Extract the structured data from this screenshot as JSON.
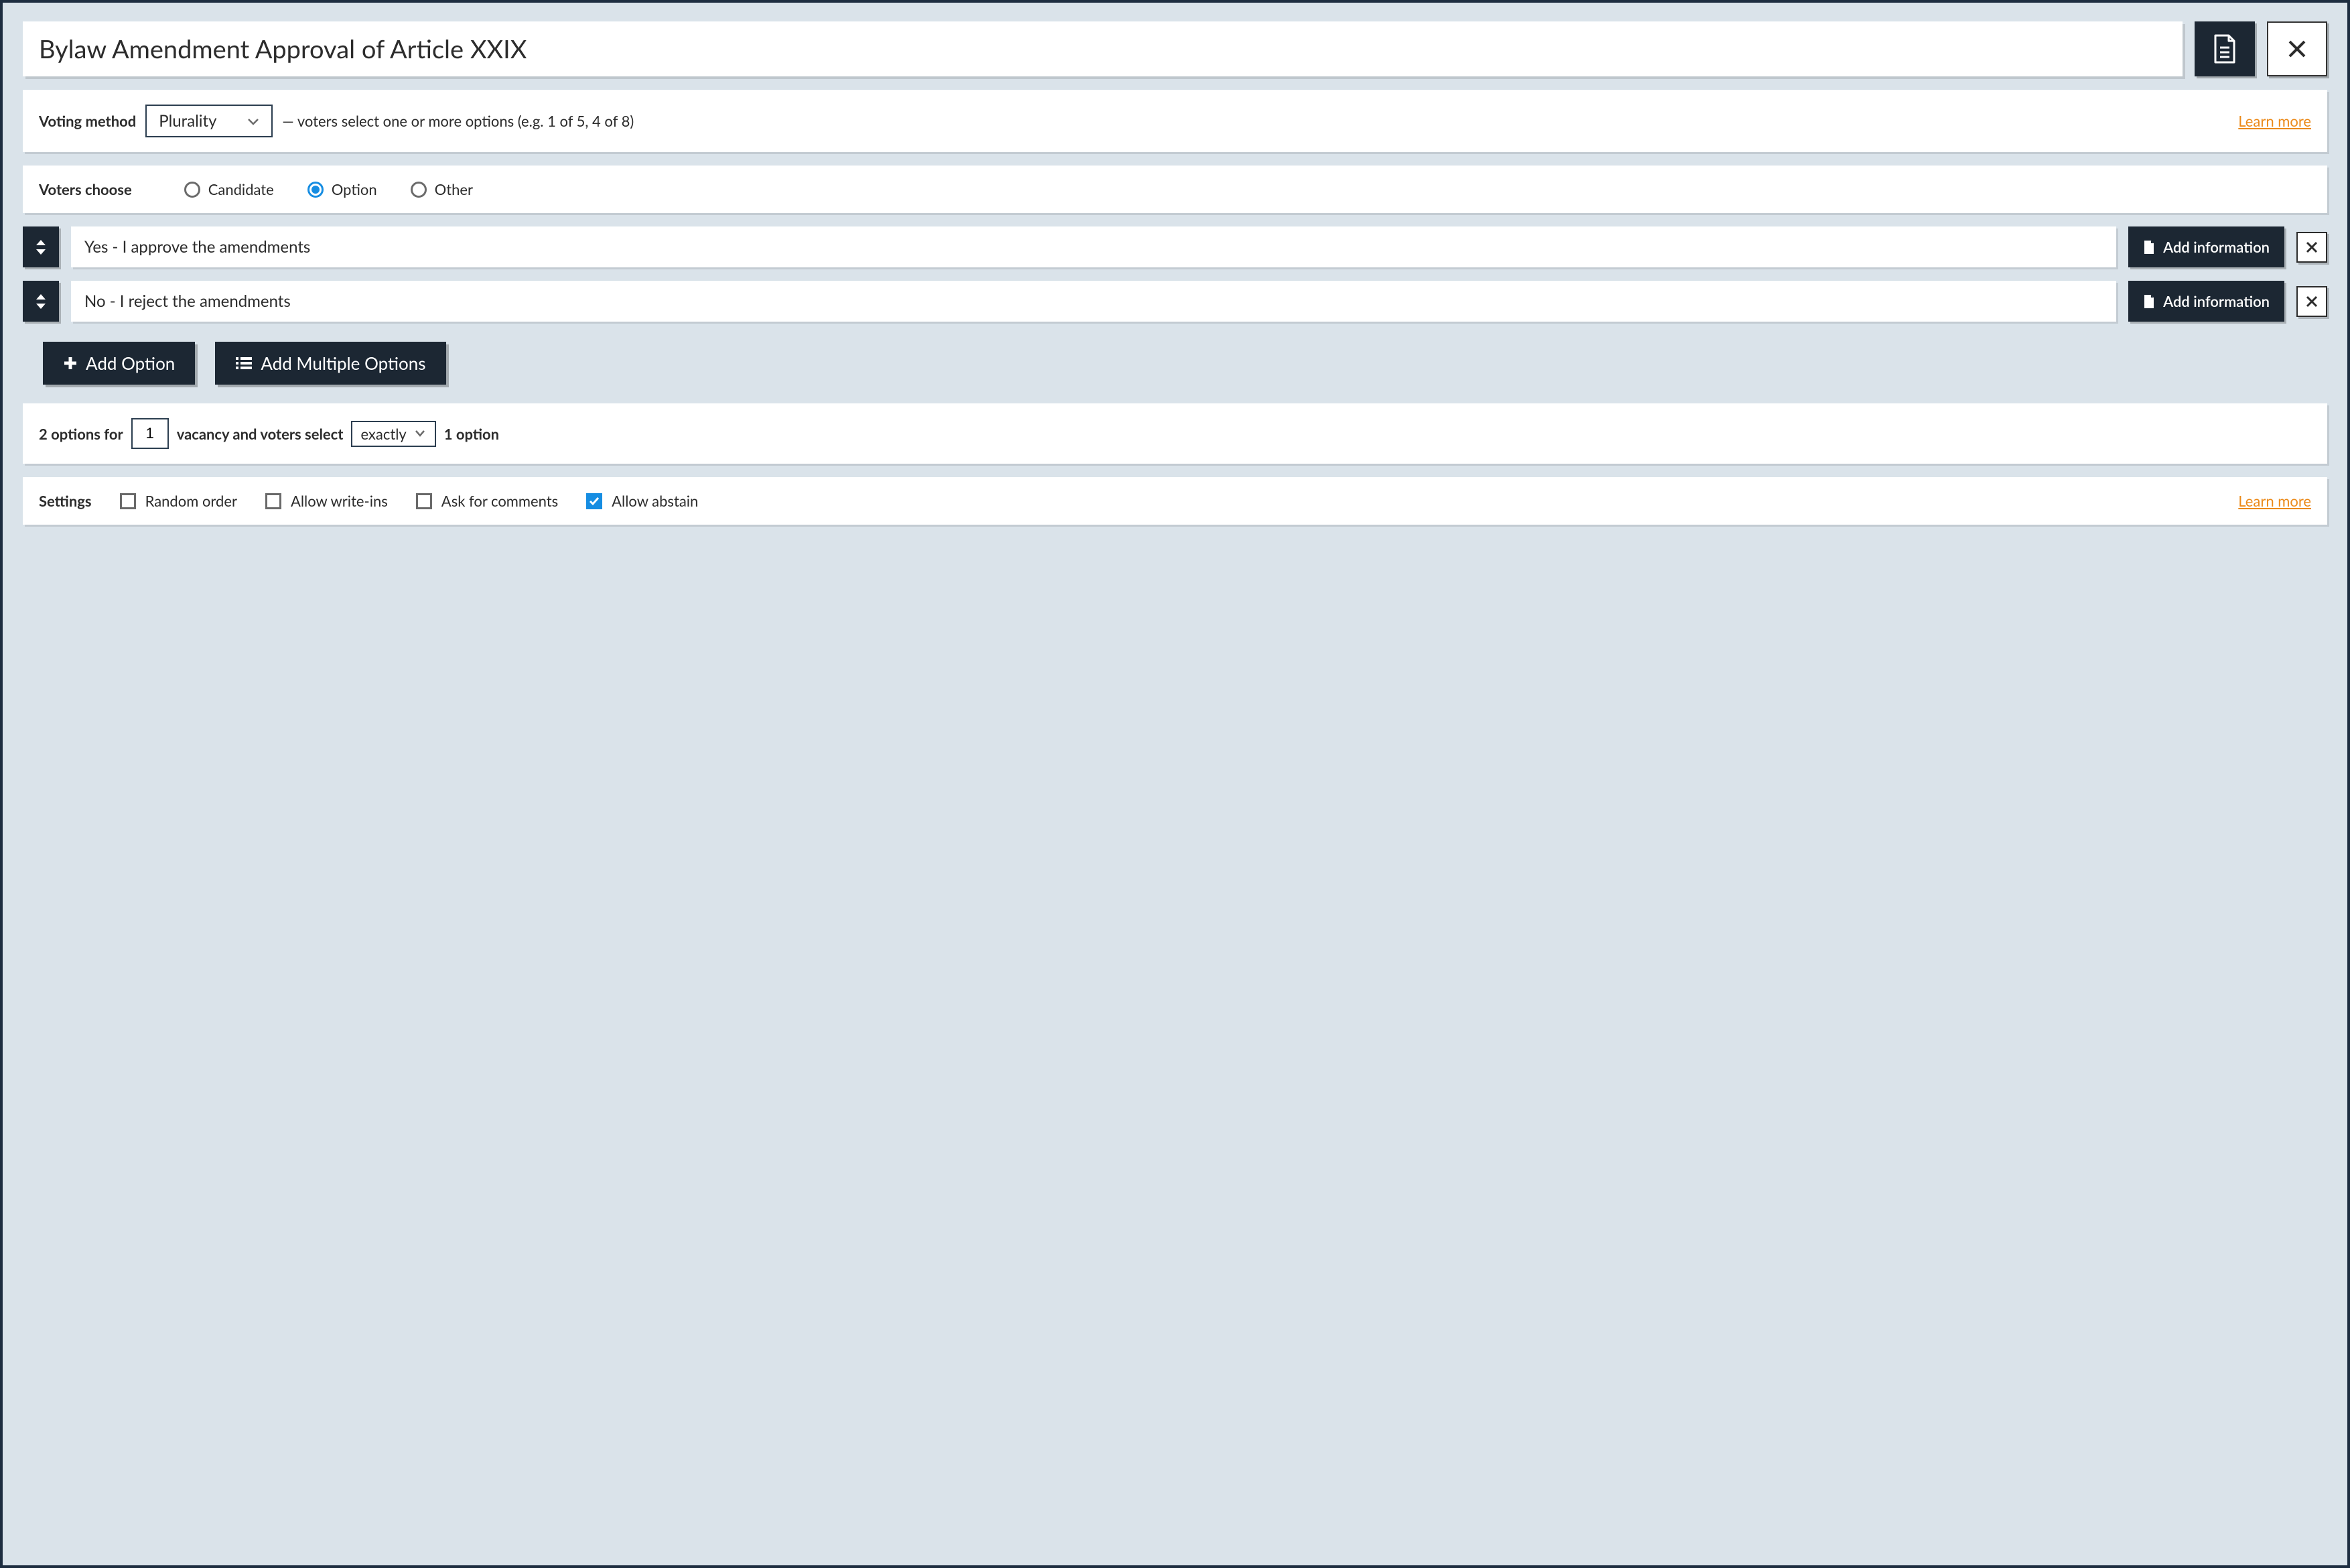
{
  "title": "Bylaw Amendment Approval of Article XXIX",
  "voting_method": {
    "label": "Voting method",
    "selected": "Plurality",
    "description": "— voters select one or more options (e.g. 1 of 5, 4 of 8)",
    "learn_more": "Learn more"
  },
  "voters_choose": {
    "label": "Voters choose",
    "options": [
      "Candidate",
      "Option",
      "Other"
    ],
    "selected_index": 1
  },
  "ballot_options": [
    {
      "text": "Yes - I approve the amendments",
      "add_info_label": "Add information"
    },
    {
      "text": "No - I reject the amendments",
      "add_info_label": "Add information"
    }
  ],
  "actions": {
    "add_option": "Add Option",
    "add_multiple": "Add Multiple Options"
  },
  "summary": {
    "prefix": "2 options for",
    "vacancy_value": "1",
    "mid": "vacancy and voters select",
    "select_mode": "exactly",
    "suffix": "1 option"
  },
  "settings": {
    "label": "Settings",
    "items": [
      {
        "label": "Random order",
        "checked": false
      },
      {
        "label": "Allow write-ins",
        "checked": false
      },
      {
        "label": "Ask for comments",
        "checked": false
      },
      {
        "label": "Allow abstain",
        "checked": true
      }
    ],
    "learn_more": "Learn more"
  }
}
